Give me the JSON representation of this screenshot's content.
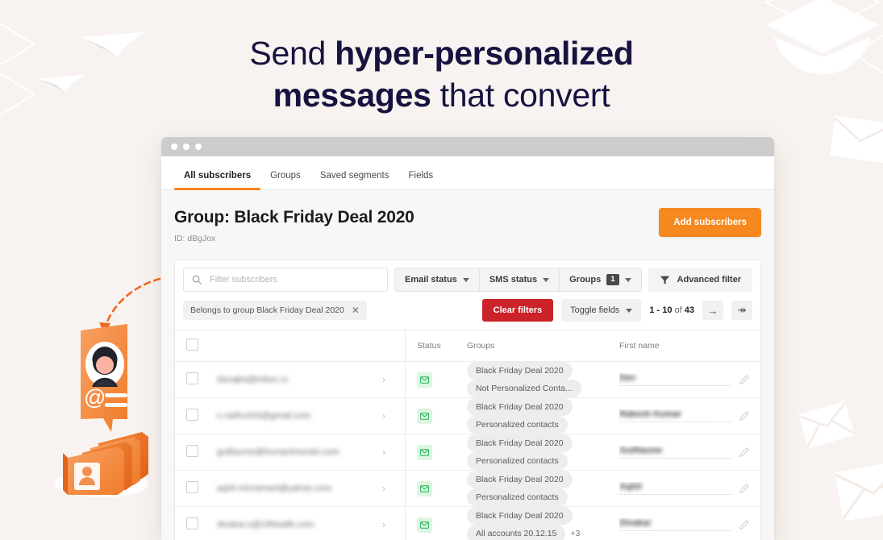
{
  "headline": {
    "line1_plain": "Send ",
    "line1_bold": "hyper-personalized",
    "line2_bold": "messages",
    "line2_plain": " that convert"
  },
  "colors": {
    "background": "#f8f3f0",
    "headline_text": "#171340",
    "accent_orange": "#f5881f",
    "danger_red": "#cc2229",
    "status_green_bg": "#ddf5e3",
    "status_green_fg": "#35b864"
  },
  "window": {
    "titlebar_dots": 3
  },
  "tabs": [
    {
      "label": "All subscribers",
      "active": true
    },
    {
      "label": "Groups",
      "active": false
    },
    {
      "label": "Saved segments",
      "active": false
    },
    {
      "label": "Fields",
      "active": false
    }
  ],
  "page": {
    "title": "Group: Black Friday Deal 2020",
    "id_label": "ID: dBgJox",
    "add_button": "Add subscribers"
  },
  "toolbar": {
    "search_placeholder": "Filter subscribers",
    "search_value": "",
    "filters": [
      {
        "label": "Email status",
        "badge": null
      },
      {
        "label": "SMS status",
        "badge": null
      },
      {
        "label": "Groups",
        "badge": "1"
      }
    ],
    "advanced_filter": "Advanced filter"
  },
  "toolbar2": {
    "chip": "Belongs to group Black Friday Deal 2020",
    "clear_filters": "Clear filters",
    "toggle_fields": "Toggle fields",
    "pager_range": "1 - 10",
    "pager_of": " of ",
    "pager_total": "43",
    "next_icon": "→",
    "last_icon": "↠"
  },
  "table": {
    "headers": {
      "checkbox": "",
      "email": "",
      "status": "Status",
      "groups": "Groups",
      "first_name": "First name"
    },
    "rows": [
      {
        "email": "davajka@inbox.ru",
        "status_icon": "envelope-icon",
        "groups": [
          "Black Friday Deal 2020",
          "Not Personalized Conta..."
        ],
        "extra_groups": null,
        "first_name": "Dev"
      },
      {
        "email": "c.radhu333@gmail.com",
        "status_icon": "envelope-icon",
        "groups": [
          "Black Friday Deal 2020",
          "Personalized contacts"
        ],
        "extra_groups": null,
        "first_name": "Rakesh Kumar"
      },
      {
        "email": "guillaume@humanimondo.com",
        "status_icon": "envelope-icon",
        "groups": [
          "Black Friday Deal 2020",
          "Personalized contacts"
        ],
        "extra_groups": null,
        "first_name": "Guillaume"
      },
      {
        "email": "aqhil.mirzamani@yahoo.com",
        "status_icon": "envelope-icon",
        "groups": [
          "Black Friday Deal 2020",
          "Personalized contacts"
        ],
        "extra_groups": null,
        "first_name": "Aqhil"
      },
      {
        "email": "divakar.s@19health.com",
        "status_icon": "envelope-icon",
        "groups": [
          "Black Friday Deal 2020",
          "All accounts 20.12.15"
        ],
        "extra_groups": "+3",
        "first_name": "Divakar"
      }
    ]
  }
}
